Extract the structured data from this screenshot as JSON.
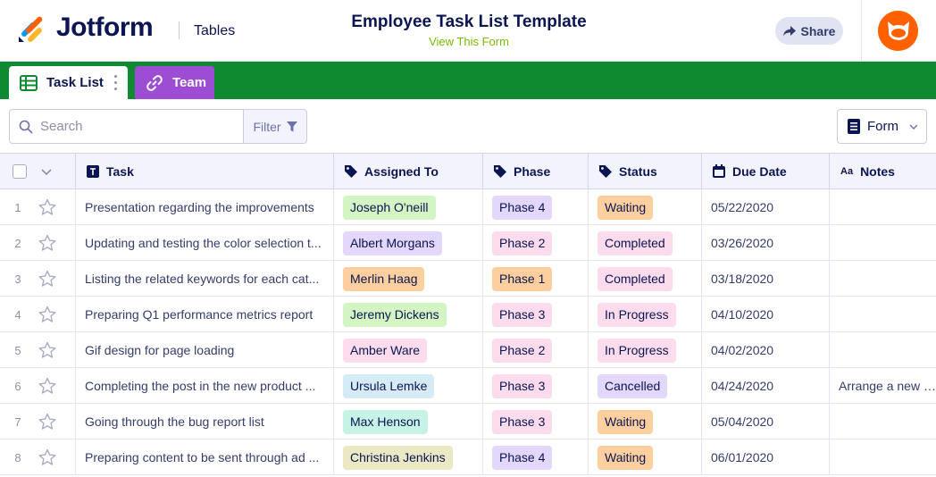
{
  "header": {
    "logo_text": "Jotform",
    "section": "Tables",
    "title": "Employee Task List Template",
    "view_form_link": "View This Form",
    "share_label": "Share"
  },
  "tabs": [
    {
      "label": "Task List",
      "active": true
    },
    {
      "label": "Team",
      "active": false
    }
  ],
  "toolbar": {
    "search_placeholder": "Search",
    "filter_label": "Filter",
    "form_label": "Form"
  },
  "columns": [
    {
      "label": "Task",
      "icon": "text-icon"
    },
    {
      "label": "Assigned To",
      "icon": "tag-icon"
    },
    {
      "label": "Phase",
      "icon": "tag-icon"
    },
    {
      "label": "Status",
      "icon": "tag-icon"
    },
    {
      "label": "Due Date",
      "icon": "calendar-icon"
    },
    {
      "label": "Notes",
      "icon": "text-aa-icon"
    }
  ],
  "rows": [
    {
      "num": "1",
      "task": "Presentation regarding the improvements",
      "assigned": "Joseph O'neill",
      "assigned_color": "#d3f5c4",
      "phase": "Phase 4",
      "phase_color": "#e3d7fb",
      "status": "Waiting",
      "status_color": "#fdcf9e",
      "due": "05/22/2020",
      "notes": ""
    },
    {
      "num": "2",
      "task": "Updating and testing the color selection t...",
      "assigned": "Albert Morgans",
      "assigned_color": "#e3d7fb",
      "phase": "Phase 2",
      "phase_color": "#fcdcec",
      "status": "Completed",
      "status_color": "#fcdcec",
      "due": "03/26/2020",
      "notes": ""
    },
    {
      "num": "3",
      "task": "Listing the related keywords for each cat...",
      "assigned": "Merlin Haag",
      "assigned_color": "#fdcf9e",
      "phase": "Phase 1",
      "phase_color": "#fdcf9e",
      "status": "Completed",
      "status_color": "#fcdcec",
      "due": "03/18/2020",
      "notes": ""
    },
    {
      "num": "4",
      "task": "Preparing Q1 performance metrics report",
      "assigned": "Jeremy Dickens",
      "assigned_color": "#d3f5c4",
      "phase": "Phase 3",
      "phase_color": "#fcdcec",
      "status": "In Progress",
      "status_color": "#fcdcec",
      "due": "04/10/2020",
      "notes": ""
    },
    {
      "num": "5",
      "task": "Gif design for page loading",
      "assigned": "Amber Ware",
      "assigned_color": "#fcdcec",
      "phase": "Phase 2",
      "phase_color": "#fcdcec",
      "status": "In Progress",
      "status_color": "#fcdcec",
      "due": "04/02/2020",
      "notes": ""
    },
    {
      "num": "6",
      "task": "Completing the post in the new product ...",
      "assigned": "Ursula Lemke",
      "assigned_color": "#d5ecf7",
      "phase": "Phase 3",
      "phase_color": "#fcdcec",
      "status": "Cancelled",
      "status_color": "#e3d7fb",
      "due": "04/24/2020",
      "notes": "Arrange a new on"
    },
    {
      "num": "7",
      "task": "Going through the bug report list",
      "assigned": "Max Henson",
      "assigned_color": "#c7f2e6",
      "phase": "Phase 3",
      "phase_color": "#fcdcec",
      "status": "Waiting",
      "status_color": "#fdcf9e",
      "due": "05/04/2020",
      "notes": ""
    },
    {
      "num": "8",
      "task": "Preparing content to be sent through ad ...",
      "assigned": "Christina Jenkins",
      "assigned_color": "#ebe8c4",
      "phase": "Phase 4",
      "phase_color": "#e3d7fb",
      "status": "Waiting",
      "status_color": "#fdcf9e",
      "due": "06/01/2020",
      "notes": ""
    }
  ],
  "colors": {
    "brand_dark": "#0a1551",
    "tabbar_green": "#0f8a31",
    "team_tab_purple": "#9c4dd3",
    "avatar_orange": "#ff6100",
    "view_form_green": "#78bb07"
  }
}
